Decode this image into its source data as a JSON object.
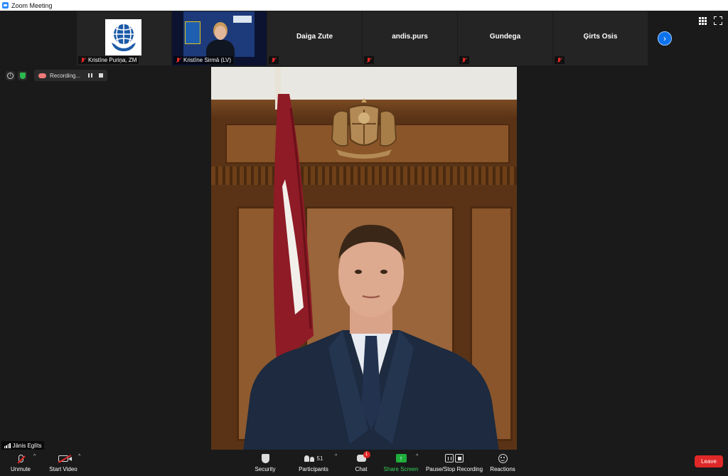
{
  "window": {
    "title": "Zoom Meeting"
  },
  "participants_strip": [
    {
      "name": "Kristīne Puriņa, ZM",
      "kind": "logo",
      "muted": true
    },
    {
      "name": "Kristīne Sirmā (LV)",
      "kind": "camera",
      "muted": true
    },
    {
      "name": "Daiga Zute",
      "kind": "name",
      "muted": true
    },
    {
      "name": "andis.purs",
      "kind": "name",
      "muted": true
    },
    {
      "name": "Gundega",
      "kind": "name",
      "muted": true
    },
    {
      "name": "Ģirts Osis",
      "kind": "name",
      "muted": true
    }
  ],
  "status": {
    "recording_text": "Recording..."
  },
  "active_speaker": {
    "name": "Jānis Eglīts"
  },
  "toolbar": {
    "unmute": "Unmute",
    "start_video": "Start Video",
    "security": "Security",
    "participants": "Participants",
    "participants_count": "51",
    "chat": "Chat",
    "chat_badge": "1",
    "share_screen": "Share Screen",
    "pause_stop_recording": "Pause/Stop Recording",
    "reactions": "Reactions",
    "leave": "Leave"
  },
  "colors": {
    "accent_blue": "#0e72ed",
    "share_green": "#1eae3c",
    "leave_red": "#e02828",
    "background": "#1a1a1a"
  },
  "icons": [
    "zoom-app-icon",
    "globe-hands-logo",
    "mic-muted-icon",
    "next-page-icon",
    "gallery-view-icon",
    "fullscreen-icon",
    "info-icon",
    "shield-icon",
    "cloud-recording-icon",
    "pause-icon",
    "stop-icon",
    "camera-off-icon",
    "participants-icon",
    "chat-icon",
    "share-screen-icon",
    "reactions-icon"
  ]
}
